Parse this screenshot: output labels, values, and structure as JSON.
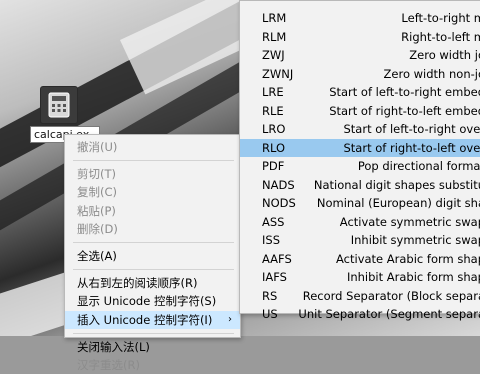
{
  "desktop_icon": {
    "label": "calcapi.ex",
    "icon": "calculator-icon"
  },
  "context_menu": {
    "items": [
      {
        "label": "撤消(U)",
        "disabled": true
      },
      {
        "label": "剪切(T)",
        "disabled": true
      },
      {
        "label": "复制(C)",
        "disabled": true
      },
      {
        "label": "粘贴(P)",
        "disabled": true
      },
      {
        "label": "删除(D)",
        "disabled": true
      },
      {
        "label": "全选(A)",
        "disabled": false
      },
      {
        "label": "从右到左的阅读顺序(R)",
        "disabled": false
      },
      {
        "label": "显示 Unicode 控制字符(S)",
        "disabled": false
      },
      {
        "label": "插入 Unicode 控制字符(I)",
        "disabled": false,
        "has_submenu": true,
        "submenu_arrow": "›"
      },
      {
        "label": "关闭输入法(L)",
        "disabled": false
      },
      {
        "label": "汉字重选(R)",
        "disabled": true
      }
    ]
  },
  "submenu": {
    "rows": [
      {
        "code": "LRM",
        "desc": "Left-to-right m"
      },
      {
        "code": "RLM",
        "desc": "Right-to-left m"
      },
      {
        "code": "ZWJ",
        "desc": "Zero width jo"
      },
      {
        "code": "ZWNJ",
        "desc": "Zero width non-jo"
      },
      {
        "code": "LRE",
        "desc": "Start of left-to-right embed"
      },
      {
        "code": "RLE",
        "desc": "Start of right-to-left embed"
      },
      {
        "code": "LRO",
        "desc": "Start of left-to-right over"
      },
      {
        "code": "RLO",
        "desc": "Start of right-to-left over"
      },
      {
        "code": "PDF",
        "desc": "Pop directional format"
      },
      {
        "code": "NADS",
        "desc": "National digit shapes substitu"
      },
      {
        "code": "NODS",
        "desc": "Nominal (European) digit sha"
      },
      {
        "code": "ASS",
        "desc": "Activate symmetric swap"
      },
      {
        "code": "ISS",
        "desc": "Inhibit symmetric swap"
      },
      {
        "code": "AAFS",
        "desc": "Activate Arabic form shap"
      },
      {
        "code": "IAFS",
        "desc": "Inhibit Arabic form shap"
      },
      {
        "code": "RS",
        "desc": "Record Separator (Block separa"
      },
      {
        "code": "US",
        "desc": "Unit Separator (Segment separa"
      }
    ],
    "active_index": 7
  },
  "colors": {
    "menu_bg": "#f2f2f2",
    "highlight": "#99c9ef",
    "hover_parent": "#cce8ff",
    "disabled_text": "#8c8c8c"
  }
}
